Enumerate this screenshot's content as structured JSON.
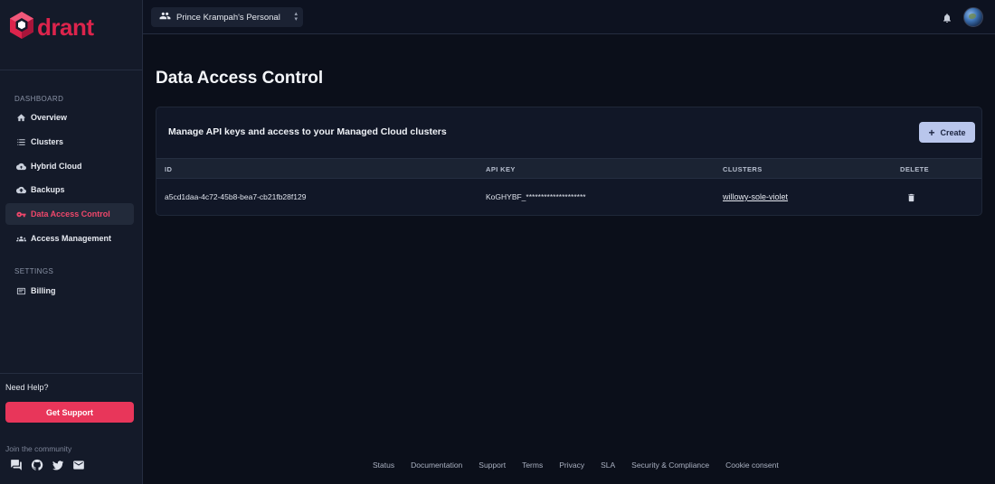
{
  "brand": {
    "logo_text": "drant",
    "accent": "#dc244c"
  },
  "sidebar": {
    "dashboard_label": "DASHBOARD",
    "items": [
      {
        "label": "Overview",
        "icon": "home-icon"
      },
      {
        "label": "Clusters",
        "icon": "list-icon"
      },
      {
        "label": "Hybrid Cloud",
        "icon": "cloud-icon"
      },
      {
        "label": "Backups",
        "icon": "cloud-upload-icon"
      },
      {
        "label": "Data Access Control",
        "icon": "key-icon",
        "active": true
      },
      {
        "label": "Access Management",
        "icon": "group-icon"
      }
    ],
    "settings_label": "SETTINGS",
    "settings_items": [
      {
        "label": "Billing",
        "icon": "billing-icon"
      }
    ],
    "help_label": "Need Help?",
    "support_button": "Get Support",
    "community_label": "Join the community"
  },
  "topbar": {
    "workspace": "Prince Krampah's Personal ..."
  },
  "main": {
    "title": "Data Access Control",
    "card_heading": "Manage API keys and access to your Managed Cloud clusters",
    "create_button": "Create",
    "columns": [
      "ID",
      "API KEY",
      "CLUSTERS",
      "DELETE"
    ],
    "rows": [
      {
        "id": "a5cd1daa-4c72-45b8-bea7-cb21fb28f129",
        "api_key": "KoGHYBF_********************",
        "cluster": "willowy-sole-violet"
      }
    ]
  },
  "footer": {
    "links": [
      "Status",
      "Documentation",
      "Support",
      "Terms",
      "Privacy",
      "SLA",
      "Security & Compliance",
      "Cookie consent"
    ]
  }
}
